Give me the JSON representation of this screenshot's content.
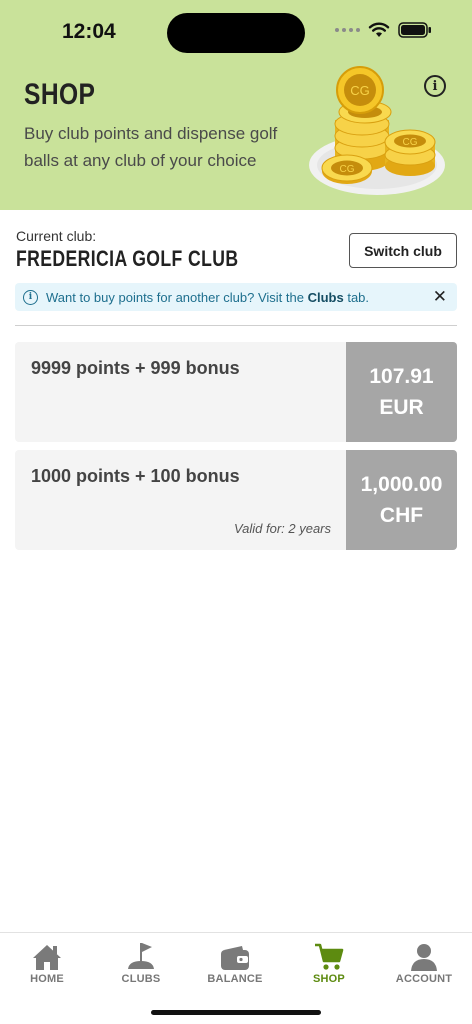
{
  "status_bar": {
    "time": "12:04"
  },
  "header": {
    "title": "SHOP",
    "description": "Buy club points and dispense golf balls at any club of your choice",
    "coin_text": "CG"
  },
  "club": {
    "label": "Current club:",
    "name": "FREDERICIA GOLF CLUB",
    "switch_label": "Switch club"
  },
  "notice": {
    "text_before": "Want to buy points for another club? Visit the ",
    "link": "Clubs",
    "text_after": " tab."
  },
  "products": [
    {
      "title": "9999 points + 999 bonus",
      "price": "107.91",
      "currency": "EUR",
      "validity": ""
    },
    {
      "title": "1000 points + 100 bonus",
      "price": "1,000.00",
      "currency": "CHF",
      "validity": "Valid for: 2 years"
    }
  ],
  "tabs": [
    {
      "label": "HOME",
      "icon": "home-icon"
    },
    {
      "label": "CLUBS",
      "icon": "golf-flag-icon"
    },
    {
      "label": "BALANCE",
      "icon": "wallet-icon"
    },
    {
      "label": "SHOP",
      "icon": "cart-icon",
      "active": true
    },
    {
      "label": "ACCOUNT",
      "icon": "person-icon"
    }
  ],
  "colors": {
    "header_bg": "#c9e29a",
    "active_tab": "#5d8b10",
    "price_bg": "#a6a6a6",
    "notice_bg": "#e6f5fb",
    "notice_text": "#1e6f8e"
  }
}
